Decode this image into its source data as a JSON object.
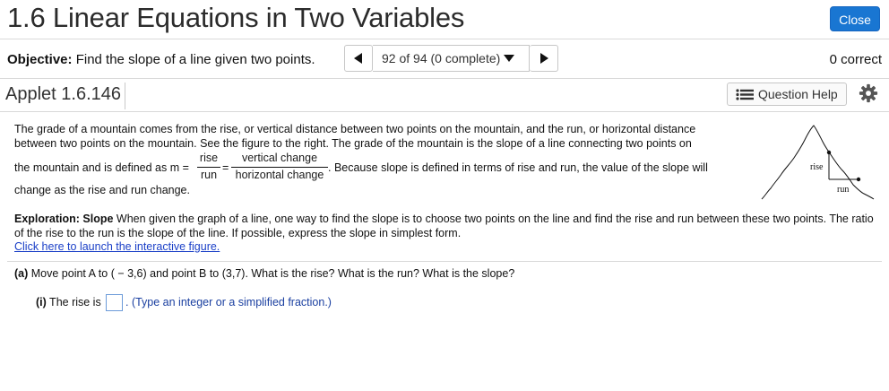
{
  "header": {
    "title": "1.6 Linear Equations in Two Variables",
    "close_label": "Close"
  },
  "objective": {
    "label": "Objective:",
    "text": "Find the slope of a line given two points.",
    "nav_selected": "92 of 94 (0 complete)",
    "score": "0 correct"
  },
  "applet": {
    "title": "Applet 1.6.146",
    "help_label": "Question Help",
    "help_icon": "list-icon",
    "settings_icon": "gear-icon"
  },
  "intro": {
    "line1": "The grade of a mountain comes from the rise, or vertical distance between two points on the mountain, and the run, or horizontal distance",
    "line2": "between two points on the mountain. See the figure to the right. The grade of the mountain is the slope of a line connecting two points on",
    "line3_pre": "the mountain and is defined as m =",
    "frac1_num": "rise",
    "frac1_den": "run",
    "equals": "=",
    "frac2_num": "vertical change",
    "frac2_den": "horizontal change",
    "line3_post": ". Because slope is defined in terms of rise and run, the value of the slope will",
    "line4": "change as the rise and run change."
  },
  "figure": {
    "rise_label": "rise",
    "run_label": "run"
  },
  "exploration": {
    "label": "Exploration: Slope",
    "text": " When given the graph of a line, one way to find the slope is to choose two points on the line and find the rise and run between these two points. The ratio of the rise to the run is the slope of the line. If possible, express the slope in simplest form.",
    "link": "Click here to launch the interactive figure."
  },
  "part_a": {
    "label": "(a)",
    "text": " Move point A to ( − 3,6) and point B to (3,7). What is the rise? What is the run? What is the slope?"
  },
  "part_i": {
    "label": "(i)",
    "text": " The rise is",
    "hint": ". (Type an integer or a simplified fraction.)"
  },
  "colors": {
    "accent": "#1976d2",
    "link": "#1a3fc7",
    "hint": "#1a3fa0"
  }
}
